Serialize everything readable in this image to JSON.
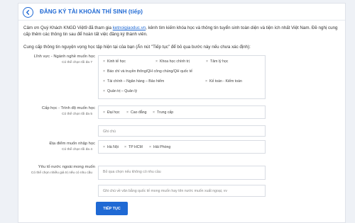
{
  "header": {
    "title": "ĐĂNG KÝ TÀI KHOẢN THÍ SINH (tiếp)"
  },
  "intro": {
    "part1": "Cảm ơn Quý Khách KNGD Việt9 đã tham gia ",
    "link": "ketnoigiaoduc.vn",
    "part2": ", kênh tìm kiếm khóa học và thông tin tuyển sinh toàn diện và tiện ích nhất Việt Nam. Đề nghị cung cấp thêm các thông tin sau để hoàn tất việc đăng ký thành viên."
  },
  "instruction": "Cung cấp thông tin nguyện vọng học tập hiện tại của bạn (Ấn nút \"Tiếp tục\" để bỏ qua bước này nếu chưa xác định):",
  "fields": {
    "field_study": {
      "label": "Lĩnh vực - Ngành nghề muốn học",
      "hint": "Có thể chọn tối đa 7",
      "tags": [
        "Kinh tế học",
        "Khoa học chính trị",
        "Tâm lý học",
        "Báo chí và truyền thông/QH công chúng/QH quốc tế",
        "Tài chính – Ngân hàng – Bảo hiểm",
        "Kế toán - Kiểm toán",
        "Quản trị – Quản lý"
      ]
    },
    "level": {
      "label": "Cấp học - Trình độ muốn học",
      "hint": "Có thể chọn tối đa 5",
      "tags": [
        "Đại học",
        "Cao đẳng",
        "Trung cấp"
      ],
      "note_placeholder": "Ghi chú"
    },
    "location": {
      "label": "Địa điểm muốn nhập học",
      "hint": "Có thể chọn tối đa 4",
      "tags": [
        "Hà Nội",
        "TP HCM",
        "Hải Phòng"
      ]
    },
    "language": {
      "label": "Yêu tố nước ngoài mong muốn",
      "hint": "Có thể chọn nhiều giá trị nếu có nhu cầu",
      "placeholder": "Bỏ qua chọn nếu không có nhu cầu",
      "note_placeholder": "Ghi chú về văn bằng quốc tế mong muốn hay tên nước muốn xuất ngoại, vv"
    }
  },
  "continue_button": "TIẾP TỤC",
  "colors": {
    "accent": "#1f69d4",
    "background": "#eef1f6"
  },
  "icons": {
    "back": "back-arrow-icon",
    "tag_remove": "remove-x-icon"
  }
}
